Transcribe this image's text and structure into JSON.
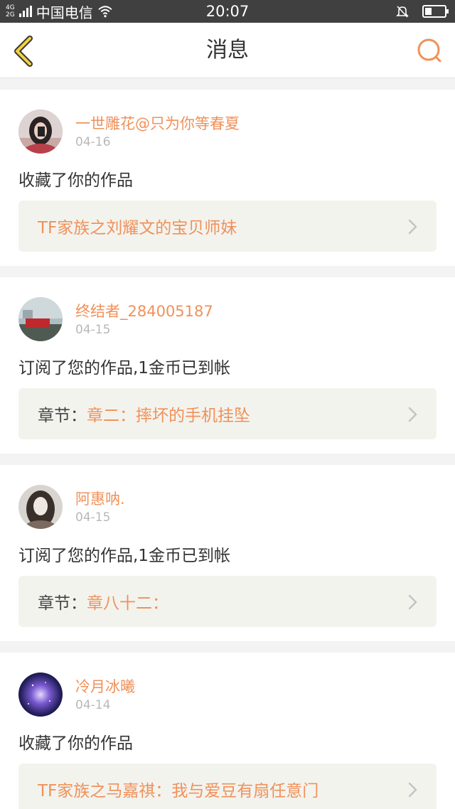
{
  "status_bar": {
    "net_top": "4G",
    "net_bottom": "2G",
    "carrier": "中国电信",
    "time": "20:07",
    "battery_level": 0.35
  },
  "header": {
    "title": "消息",
    "back_icon": "chevron-left-icon",
    "search_icon": "search-icon",
    "accent_color": "#f0915a"
  },
  "messages": [
    {
      "username": "一世雕花@只为你等春夏",
      "date": "04-16",
      "action": "收藏了你的作品",
      "link_prefix": "",
      "link_title": "TF家族之刘耀文的宝贝师妹"
    },
    {
      "username": "终结者_284005187",
      "date": "04-15",
      "action": "订阅了您的作品,1金币已到帐",
      "link_prefix": "章节：",
      "link_title": "章二：摔坏的手机挂坠"
    },
    {
      "username": "阿惠呐.",
      "date": "04-15",
      "action": "订阅了您的作品,1金币已到帐",
      "link_prefix": "章节：",
      "link_title": "章八十二："
    },
    {
      "username": "冷月冰曦",
      "date": "04-14",
      "action": "收藏了你的作品",
      "link_prefix": "",
      "link_title": "TF家族之马嘉祺：我与爱豆有扇任意门"
    }
  ]
}
